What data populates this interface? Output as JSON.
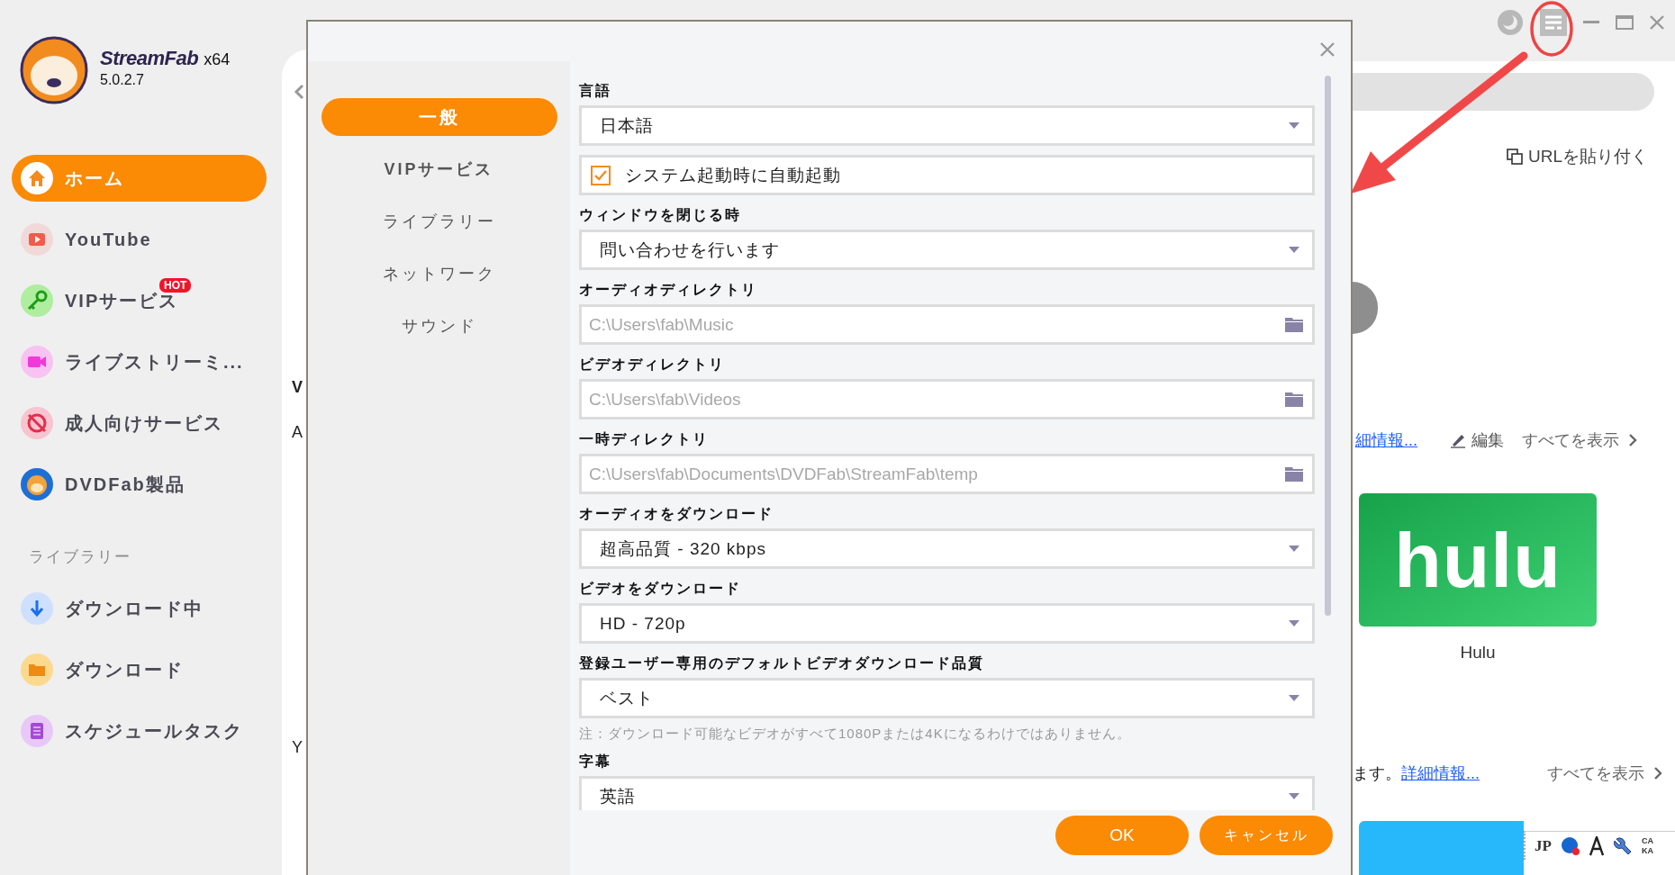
{
  "app": {
    "name": "StreamFab",
    "edition": "x64",
    "version": "5.0.2.7"
  },
  "sidebar": {
    "items": [
      {
        "label": "ホーム",
        "selected": true
      },
      {
        "label": "YouTube",
        "selected": false
      },
      {
        "label": "VIPサービス",
        "selected": false,
        "badge": "HOT"
      },
      {
        "label": "ライブストリーミ...",
        "selected": false
      },
      {
        "label": "成人向けサービス",
        "selected": false
      },
      {
        "label": "DVDFab製品",
        "selected": false
      }
    ],
    "library": {
      "title": "ライブラリー",
      "items": [
        {
          "label": "ダウンロード中",
          "selected": false
        },
        {
          "label": "ダウンロード",
          "selected": false
        },
        {
          "label": "スケジュールタスク",
          "selected": false
        }
      ]
    }
  },
  "main": {
    "cut_texts": [
      "V",
      "A",
      "Y"
    ],
    "paste_url": "URLを貼り付く",
    "row_1": {
      "link": "細情報...",
      "edit": "編集",
      "show_all": "すべてを表示"
    },
    "tile": {
      "logo": "hulu",
      "name": "Hulu"
    },
    "row_2": {
      "text": "ます。",
      "link": "詳細情報...",
      "show_all": "すべてを表示"
    }
  },
  "ime_bar": {
    "language": "JP",
    "caps": "CA",
    "kana": "KA"
  },
  "dialog": {
    "nav": [
      {
        "label": "一般",
        "selected": true
      },
      {
        "label": "VIPサービス",
        "selected": false
      },
      {
        "label": "ライブラリー",
        "selected": false
      },
      {
        "label": "ネットワーク",
        "selected": false
      },
      {
        "label": "サウンド",
        "selected": false
      }
    ],
    "fields": [
      {
        "kind": "select",
        "label": "言語",
        "value": "日本語"
      },
      {
        "kind": "checkbox",
        "text": "システム起動時に自動起動",
        "checked": true
      },
      {
        "kind": "select",
        "label": "ウィンドウを閉じる時",
        "value": "問い合わせを行います"
      },
      {
        "kind": "path",
        "label": "オーディオディレクトリ",
        "value": "C:\\Users\\fab\\Music",
        "disabled": true
      },
      {
        "kind": "path",
        "label": "ビデオディレクトリ",
        "value": "C:\\Users\\fab\\Videos",
        "disabled": true
      },
      {
        "kind": "path",
        "label": "一時ディレクトリ",
        "value": "C:\\Users\\fab\\Documents\\DVDFab\\StreamFab\\temp",
        "disabled": true
      },
      {
        "kind": "select",
        "label": "オーディオをダウンロード",
        "value": "超高品質 - 320 kbps"
      },
      {
        "kind": "select",
        "label": "ビデオをダウンロード",
        "value": "HD - 720p"
      },
      {
        "kind": "select",
        "label": "登録ユーザー専用のデフォルトビデオダウンロード品質",
        "value": "ベスト"
      },
      {
        "kind": "note",
        "text": "注：ダウンロード可能なビデオがすべて1080Pまたは4Kになるわけではありません。"
      },
      {
        "kind": "select",
        "label": "字幕",
        "value": "英語"
      }
    ],
    "buttons": [
      {
        "label": "OK"
      },
      {
        "label": "キャンセル"
      }
    ]
  }
}
